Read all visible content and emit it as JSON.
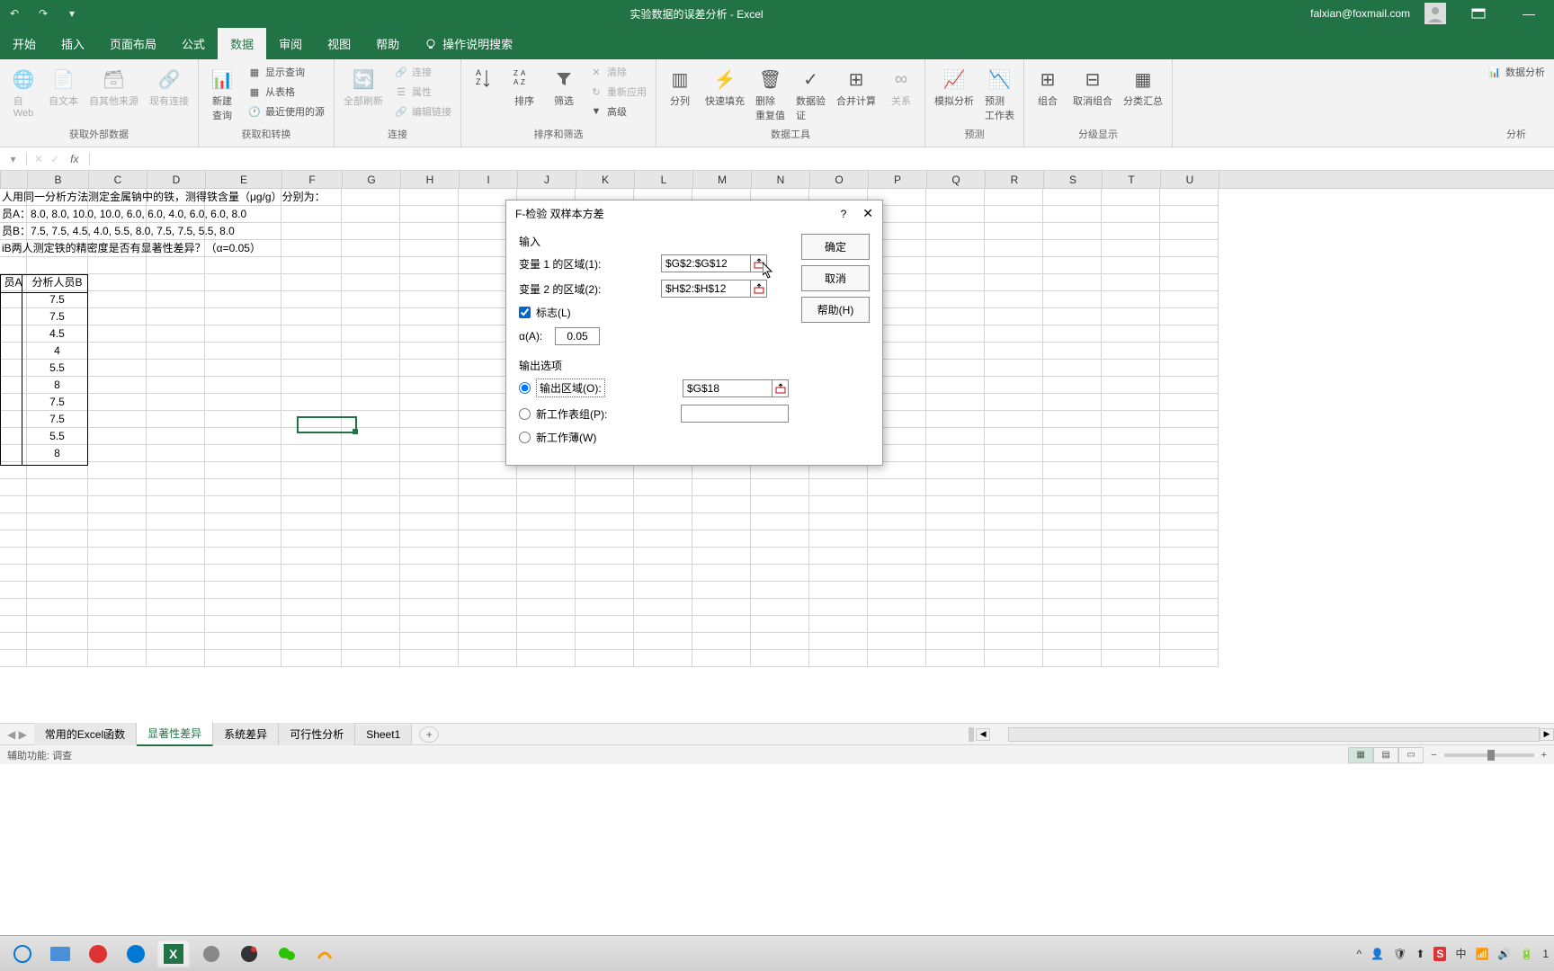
{
  "titlebar": {
    "title": "实验数据的误差分析 - Excel",
    "user_email": "falxian@foxmail.com"
  },
  "tabs": {
    "start": "开始",
    "insert": "插入",
    "layout": "页面布局",
    "formula": "公式",
    "data": "数据",
    "review": "审阅",
    "view": "视图",
    "help": "帮助",
    "tellme": "操作说明搜索"
  },
  "ribbon": {
    "group1": {
      "from_web": "自\nWeb",
      "from_text": "自文本",
      "from_other": "自其他来源",
      "existing": "现有连接",
      "label": "获取外部数据"
    },
    "group2": {
      "newquery": "新建\n查询",
      "showquery": "显示查询",
      "fromtable": "从表格",
      "recent": "最近使用的源",
      "label": "获取和转换"
    },
    "group3": {
      "refresh": "全部刷新",
      "conn": "连接",
      "prop": "属性",
      "edit": "编辑链接",
      "label": "连接"
    },
    "group4": {
      "sort": "排序",
      "filter": "筛选",
      "clear": "清除",
      "reapply": "重新应用",
      "advanced": "高级",
      "label": "排序和筛选"
    },
    "group5": {
      "split": "分列",
      "flash": "快速填充",
      "dedup": "删除\n重复值",
      "valid": "数据验\n证",
      "consol": "合并计算",
      "rel": "关系",
      "label": "数据工具"
    },
    "group6": {
      "whatif": "模拟分析",
      "forecast": "预测\n工作表",
      "label": "预测"
    },
    "group7": {
      "group": "组合",
      "ungroup": "取消组合",
      "subtotal": "分类汇总",
      "label": "分级显示"
    },
    "group8": {
      "analysis": "数据分析",
      "label": "分析"
    }
  },
  "cols": [
    "B",
    "C",
    "D",
    "E",
    "F",
    "G",
    "H",
    "I",
    "J",
    "K",
    "L",
    "M",
    "N",
    "O",
    "P",
    "Q",
    "R",
    "S",
    "T",
    "U"
  ],
  "text_rows": [
    "人用同一分析方法测定金属钠中的铁，测得铁含量（μg/g）分别为：",
    "员A：8.0, 8.0, 10.0, 10.0, 6.0, 6.0, 4.0, 6.0, 6.0, 8.0",
    "员B：7.5, 7.5, 4.5, 4.0, 5.5, 8.0, 7.5, 7.5, 5.5, 8.0",
    "iB两人测定铁的精密度是否有显著性差异？（α=0.05）"
  ],
  "table_headers": [
    "员A",
    "分析人员B"
  ],
  "table_b": [
    "7.5",
    "7.5",
    "4.5",
    "4",
    "5.5",
    "8",
    "7.5",
    "7.5",
    "5.5",
    "8"
  ],
  "dialog": {
    "title": "F-检验 双样本方差",
    "help_icon": "?",
    "input_label": "输入",
    "var1_label": "变量 1 的区域(1):",
    "var1_value": "$G$2:$G$12",
    "var2_label": "变量 2 的区域(2):",
    "var2_value": "$H$2:$H$12",
    "labels_check": "标志(L)",
    "alpha_label": "α(A):",
    "alpha_value": "0.05",
    "output_label": "输出选项",
    "out_range": "输出区域(O):",
    "out_range_value": "$G$18",
    "new_sheet": "新工作表组(P):",
    "new_book": "新工作薄(W)",
    "ok": "确定",
    "cancel": "取消",
    "help": "帮助(H)"
  },
  "sheets": {
    "s1": "常用的Excel函数",
    "s2": "显著性差异",
    "s3": "系统差异",
    "s4": "可行性分析",
    "s5": "Sheet1"
  },
  "statusbar": {
    "left": "辅助功能: 调查"
  },
  "taskbar_time": "1"
}
